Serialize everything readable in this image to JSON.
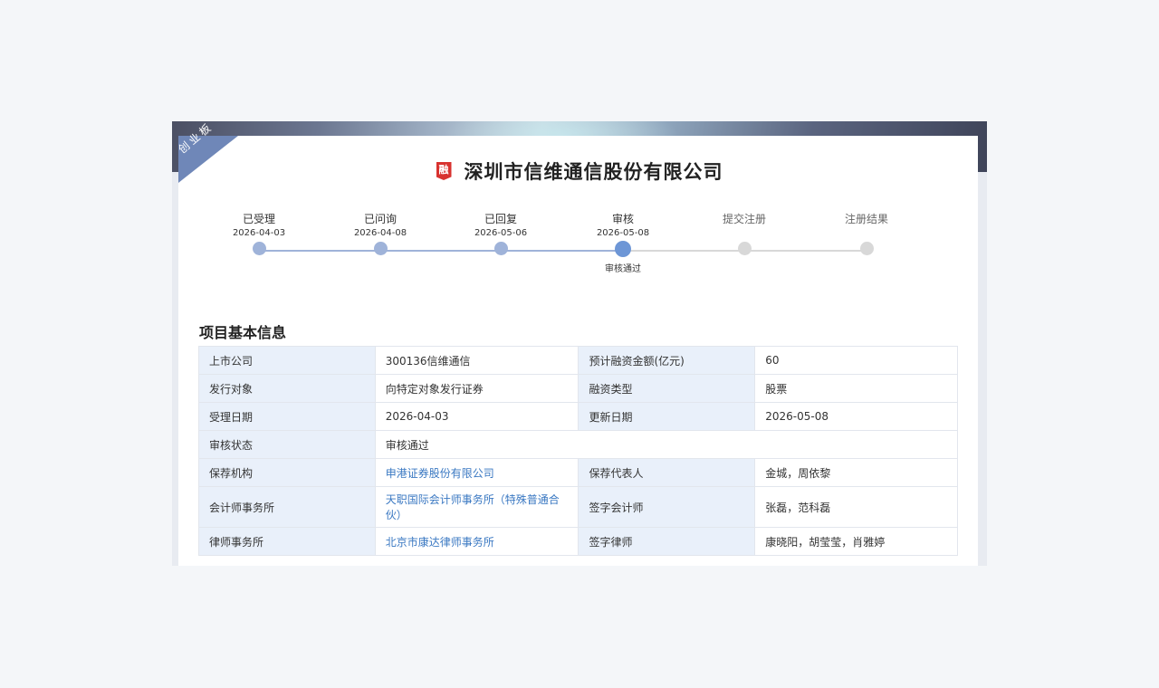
{
  "board_tag": "创业板",
  "financing_icon": "融",
  "company_name": "深圳市信维通信股份有限公司",
  "steps": [
    {
      "label": "已受理",
      "date": "2026-04-03",
      "status": "done"
    },
    {
      "label": "已问询",
      "date": "2026-04-08",
      "status": "done"
    },
    {
      "label": "已回复",
      "date": "2026-05-06",
      "status": "done"
    },
    {
      "label": "审核",
      "date": "2026-05-08",
      "status": "current",
      "sub": "审核通过"
    },
    {
      "label": "提交注册",
      "date": "",
      "status": "pending"
    },
    {
      "label": "注册结果",
      "date": "",
      "status": "pending"
    }
  ],
  "section_title": "项目基本信息",
  "info": {
    "listed_company_label": "上市公司",
    "listed_company": "300136信维通信",
    "est_financing_label": "预计融资金额(亿元)",
    "est_financing": "60",
    "issue_target_label": "发行对象",
    "issue_target": "向特定对象发行证券",
    "financing_type_label": "融资类型",
    "financing_type": "股票",
    "accept_date_label": "受理日期",
    "accept_date": "2026-04-03",
    "update_date_label": "更新日期",
    "update_date": "2026-05-08",
    "review_status_label": "审核状态",
    "review_status": "审核通过",
    "sponsor_label": "保荐机构",
    "sponsor": "申港证券股份有限公司",
    "sponsor_rep_label": "保荐代表人",
    "sponsor_rep": "金城，周依黎",
    "accounting_firm_label": "会计师事务所",
    "accounting_firm": "天职国际会计师事务所（特殊普通合伙）",
    "accountant_label": "签字会计师",
    "accountant": "张磊，范科磊",
    "law_firm_label": "律师事务所",
    "law_firm": "北京市康达律师事务所",
    "lawyer_label": "签字律师",
    "lawyer": "康晓阳，胡莹莹，肖雅婷"
  },
  "colors": {
    "ribbon": "#6f87b8",
    "icon_red": "#d8322f",
    "link": "#3a78c2",
    "key_cell_bg": "#e9f0fa",
    "step_done": "#9fb3d9",
    "step_current": "#6d96d6",
    "step_pending": "#d8d8d8"
  }
}
